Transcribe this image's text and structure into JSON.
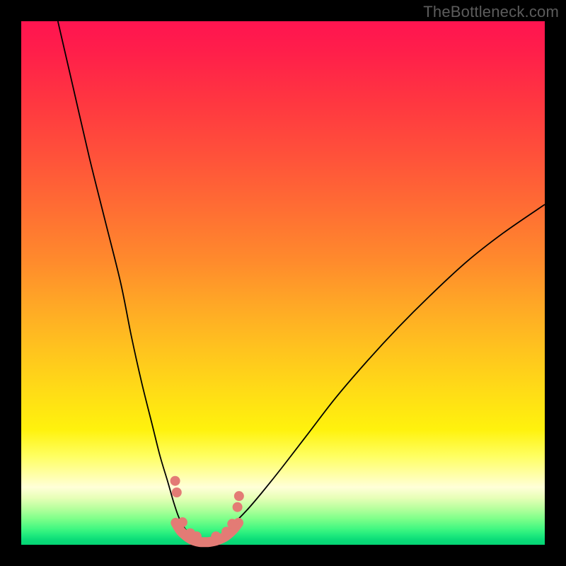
{
  "watermark": "TheBottleneck.com",
  "colors": {
    "frame": "#000000",
    "curve": "#000000",
    "marker": "#e37b75"
  },
  "chart_data": {
    "type": "line",
    "title": "",
    "xlabel": "",
    "ylabel": "",
    "xlim": [
      0,
      100
    ],
    "ylim": [
      0,
      100
    ],
    "note": "Axes are unlabeled in the source image; x and y values are estimated in percent of the plotting area (x left→right, y = height above bottom).",
    "series": [
      {
        "name": "left-descending-curve",
        "x": [
          7,
          10,
          13,
          16,
          19,
          21,
          23,
          25,
          26.5,
          28,
          29,
          30,
          31,
          32,
          33,
          34
        ],
        "values": [
          100,
          87,
          74,
          62,
          50,
          40,
          31,
          23,
          17,
          12,
          8.5,
          5.5,
          3.5,
          2.2,
          1.2,
          0.7
        ]
      },
      {
        "name": "right-ascending-curve",
        "x": [
          36,
          38,
          40,
          43,
          46,
          50,
          55,
          60,
          66,
          72,
          78,
          85,
          92,
          100
        ],
        "values": [
          0.7,
          1.8,
          3.5,
          6.5,
          10,
          15,
          21.5,
          28,
          35,
          41.5,
          47.5,
          54,
          59.5,
          65
        ]
      },
      {
        "name": "bottom-connector",
        "x": [
          29.5,
          30.5,
          32,
          33,
          34,
          35,
          36,
          37.5,
          39,
          40.5,
          41.5
        ],
        "values": [
          4.2,
          2.6,
          1.3,
          0.8,
          0.55,
          0.5,
          0.55,
          0.9,
          1.6,
          2.9,
          4.2
        ]
      }
    ],
    "markers": {
      "name": "pink-dots",
      "x": [
        29.4,
        29.7,
        30.8,
        32.3,
        33.5,
        37.2,
        39.2,
        40.3,
        41.3,
        41.6
      ],
      "values": [
        12.2,
        10.0,
        4.3,
        2.2,
        1.6,
        1.6,
        2.5,
        4.0,
        7.2,
        9.3
      ],
      "radius": 7
    }
  }
}
